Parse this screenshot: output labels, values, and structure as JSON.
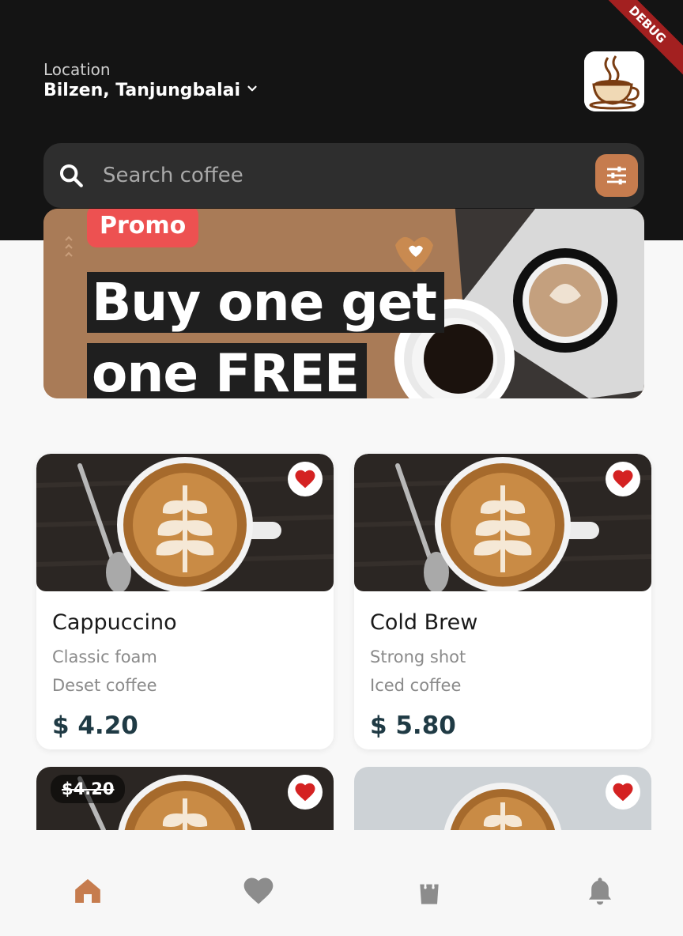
{
  "header": {
    "location_label": "Location",
    "location_value": "Bilzen, Tanjungbalai",
    "location_chevron_icon": "chevron-down-icon",
    "avatar_icon": "coffee-cup-logo-icon",
    "debug_label": "DEBUG"
  },
  "search": {
    "placeholder": "Search coffee",
    "value": "",
    "search_icon": "search-icon",
    "filter_icon": "filter-sliders-icon"
  },
  "promo": {
    "badge": "Promo",
    "line1": "Buy one get",
    "line2": "one FREE"
  },
  "products": [
    {
      "name": "Cappuccino",
      "subtitle": "Classic foam",
      "category": "Deset coffee",
      "price": "$ 4.20",
      "favorite": true
    },
    {
      "name": "Cold Brew",
      "subtitle": "Strong shot",
      "category": "Iced coffee",
      "price": "$ 5.80",
      "favorite": true
    }
  ],
  "partial_products": [
    {
      "old_price": "$4.20",
      "favorite": true
    },
    {
      "favorite": true
    }
  ],
  "bottom_nav": [
    {
      "name": "home",
      "icon": "home-icon",
      "active": true
    },
    {
      "name": "favorites",
      "icon": "heart-icon",
      "active": false
    },
    {
      "name": "cart",
      "icon": "shopping-bag-icon",
      "active": false
    },
    {
      "name": "notifications",
      "icon": "bell-icon",
      "active": false
    }
  ],
  "colors": {
    "accent": "#c67c4e",
    "header_bg": "#141414",
    "promo_badge": "#ed5151",
    "favorite": "#d42222",
    "inactive_nav": "#8c8c8c"
  }
}
